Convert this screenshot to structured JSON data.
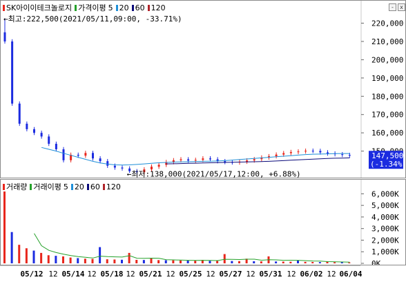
{
  "price_legend": {
    "stock_name": "SK아이이테크놀로지",
    "ma_label": "가격이평",
    "ma": [
      "5",
      "20",
      "60",
      "120"
    ]
  },
  "volume_legend": {
    "name": "거래량",
    "ma_label": "거래이평",
    "ma": [
      "5",
      "20",
      "60",
      "120"
    ]
  },
  "annotations": {
    "high": "←최고:222,500(2021/05/11,09:00, -33.71%)",
    "low": "←최저:138,000(2021/05/17,12:00, +6.88%)"
  },
  "current_price": {
    "value": "147,500",
    "change": "(-1.34%)"
  },
  "window_buttons": {
    "minimize": "-",
    "close": "x"
  },
  "colors": {
    "up": "#e8261c",
    "down": "#1b2be0",
    "ma5": "#25a12a",
    "ma20": "#1e8fd8",
    "ma60": "#0a0a7a",
    "ma120": "#b0242a",
    "price_tag_bg": "#1b2be0"
  },
  "chart_data": [
    {
      "type": "candlestick",
      "title": "SK아이이테크놀로지",
      "y_ticks": [
        "220,000",
        "210,000",
        "200,000",
        "190,000",
        "180,000",
        "170,000",
        "160,000",
        "150,000"
      ],
      "ylim": [
        137000,
        227000
      ],
      "high": 222500,
      "low": 138000,
      "last": 147500,
      "close_series": [
        210000,
        176000,
        165000,
        162000,
        160000,
        158000,
        154000,
        151000,
        145000,
        148000,
        147500,
        149000,
        146000,
        144500,
        142000,
        141000,
        140500,
        139000,
        138500,
        140000,
        141500,
        142500,
        144000,
        145000,
        145500,
        144800,
        145200,
        146000,
        145500,
        144500,
        144000,
        143800,
        144200,
        144900,
        145600,
        146500,
        147200,
        148100,
        148900,
        149500,
        149800,
        150200,
        150100,
        149300,
        148700,
        148300,
        147900,
        147500
      ],
      "ma20": [
        null,
        null,
        null,
        null,
        null,
        152000,
        151000,
        150000,
        148800,
        147700,
        146600,
        145500,
        144400,
        143500,
        142900,
        142500,
        142400,
        142500,
        142700,
        143000,
        143300,
        143600,
        143800,
        144000,
        144100,
        144200,
        144300,
        144400,
        144500,
        144600,
        144800,
        145100,
        145400,
        145700,
        146000,
        146300,
        146600,
        146900,
        147200,
        147500,
        147800,
        148100,
        148300,
        148400,
        148500,
        148600,
        148700,
        148700
      ],
      "ma60": [
        null,
        null,
        null,
        null,
        null,
        null,
        null,
        null,
        null,
        null,
        null,
        null,
        null,
        null,
        null,
        null,
        null,
        null,
        null,
        null,
        null,
        null,
        143000,
        143100,
        143200,
        143300,
        143400,
        143500,
        143600,
        143700,
        143800,
        143900,
        144000,
        144100,
        144200,
        144300,
        144400,
        144600,
        144800,
        145000,
        145200,
        145400,
        145600,
        145800,
        146000,
        146100,
        146200,
        146300
      ]
    },
    {
      "type": "bar",
      "title": "거래량",
      "y_ticks": [
        "6,000K",
        "5,000K",
        "4,000K",
        "3,000K",
        "2,000K",
        "1,000K",
        "0K"
      ],
      "ylim": [
        0,
        6500000
      ],
      "values": [
        6200000,
        2700000,
        1600000,
        1300000,
        1100000,
        900000,
        700000,
        650000,
        600000,
        500000,
        450000,
        400000,
        380000,
        1400000,
        350000,
        330000,
        310000,
        900000,
        300000,
        290000,
        450000,
        280000,
        270000,
        260000,
        250000,
        240000,
        230000,
        300000,
        220000,
        210000,
        800000,
        200000,
        190000,
        400000,
        180000,
        170000,
        600000,
        160000,
        150000,
        140000,
        250000,
        130000,
        120000,
        110000,
        150000,
        100000,
        90000,
        80000
      ],
      "ma5": [
        null,
        null,
        null,
        null,
        2580000,
        1520000,
        1120000,
        930000,
        790000,
        670000,
        580000,
        520000,
        460000,
        620000,
        580000,
        560000,
        540000,
        660000,
        440000,
        430000,
        450000,
        440000,
        310000,
        300000,
        280000,
        260000,
        250000,
        260000,
        250000,
        240000,
        350000,
        340000,
        330000,
        360000,
        360000,
        270000,
        310000,
        300000,
        260000,
        270000,
        260000,
        230000,
        200000,
        190000,
        150000,
        130000,
        120000,
        110000
      ]
    }
  ],
  "x_axis": {
    "labels": [
      "05/12",
      "12",
      "05/14",
      "12",
      "05/18",
      "12",
      "05/21",
      "12",
      "05/25",
      "12",
      "05/27",
      "12",
      "05/31",
      "12",
      "06/02",
      "12",
      "06/04"
    ],
    "bold": [
      true,
      false,
      true,
      false,
      true,
      false,
      true,
      false,
      true,
      false,
      true,
      false,
      true,
      false,
      true,
      false,
      true
    ]
  }
}
